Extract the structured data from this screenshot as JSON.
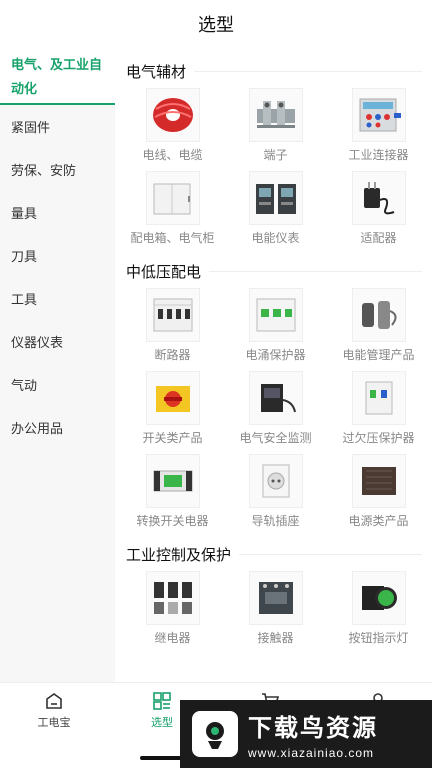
{
  "header": {
    "title": "选型"
  },
  "sidebar": {
    "items": [
      {
        "label": "电气、及工业自动化",
        "active": true
      },
      {
        "label": "紧固件"
      },
      {
        "label": "劳保、安防"
      },
      {
        "label": "量具"
      },
      {
        "label": "刀具"
      },
      {
        "label": "工具"
      },
      {
        "label": "仪器仪表"
      },
      {
        "label": "气动"
      },
      {
        "label": "办公用品"
      }
    ]
  },
  "sections": [
    {
      "title": "电气辅材",
      "products": [
        {
          "label": "电线、电缆",
          "icon": "cable-coil-icon"
        },
        {
          "label": "端子",
          "icon": "terminal-block-icon"
        },
        {
          "label": "工业连接器",
          "icon": "industrial-connector-icon"
        },
        {
          "label": "配电箱、电气柜",
          "icon": "distribution-box-icon"
        },
        {
          "label": "电能仪表",
          "icon": "energy-meter-icon"
        },
        {
          "label": "适配器",
          "icon": "adapter-icon"
        }
      ]
    },
    {
      "title": "中低压配电",
      "products": [
        {
          "label": "断路器",
          "icon": "circuit-breaker-icon"
        },
        {
          "label": "电涌保护器",
          "icon": "surge-protector-icon"
        },
        {
          "label": "电能管理产品",
          "icon": "energy-management-icon"
        },
        {
          "label": "开关类产品",
          "icon": "switch-icon"
        },
        {
          "label": "电气安全监测",
          "icon": "safety-monitor-icon"
        },
        {
          "label": "过欠压保护器",
          "icon": "voltage-protector-icon"
        },
        {
          "label": "转换开关电器",
          "icon": "transfer-switch-icon"
        },
        {
          "label": "导轨插座",
          "icon": "rail-socket-icon"
        },
        {
          "label": "电源类产品",
          "icon": "power-supply-icon"
        }
      ]
    },
    {
      "title": "工业控制及保护",
      "products": [
        {
          "label": "继电器",
          "icon": "relay-icon"
        },
        {
          "label": "接触器",
          "icon": "contactor-icon"
        },
        {
          "label": "按钮指示灯",
          "icon": "push-button-icon"
        }
      ]
    }
  ],
  "tabbar": {
    "items": [
      {
        "label": "工电宝",
        "icon": "home-icon"
      },
      {
        "label": "选型",
        "icon": "grid-icon",
        "active": true
      },
      {
        "label": "",
        "icon": "cart-icon"
      },
      {
        "label": "",
        "icon": "user-icon"
      }
    ]
  },
  "watermark": {
    "title": "下载鸟资源",
    "url": "www.xiazainiao.com"
  },
  "colors": {
    "accent": "#18a26b",
    "sidebar_bg": "#f7f7f7"
  }
}
